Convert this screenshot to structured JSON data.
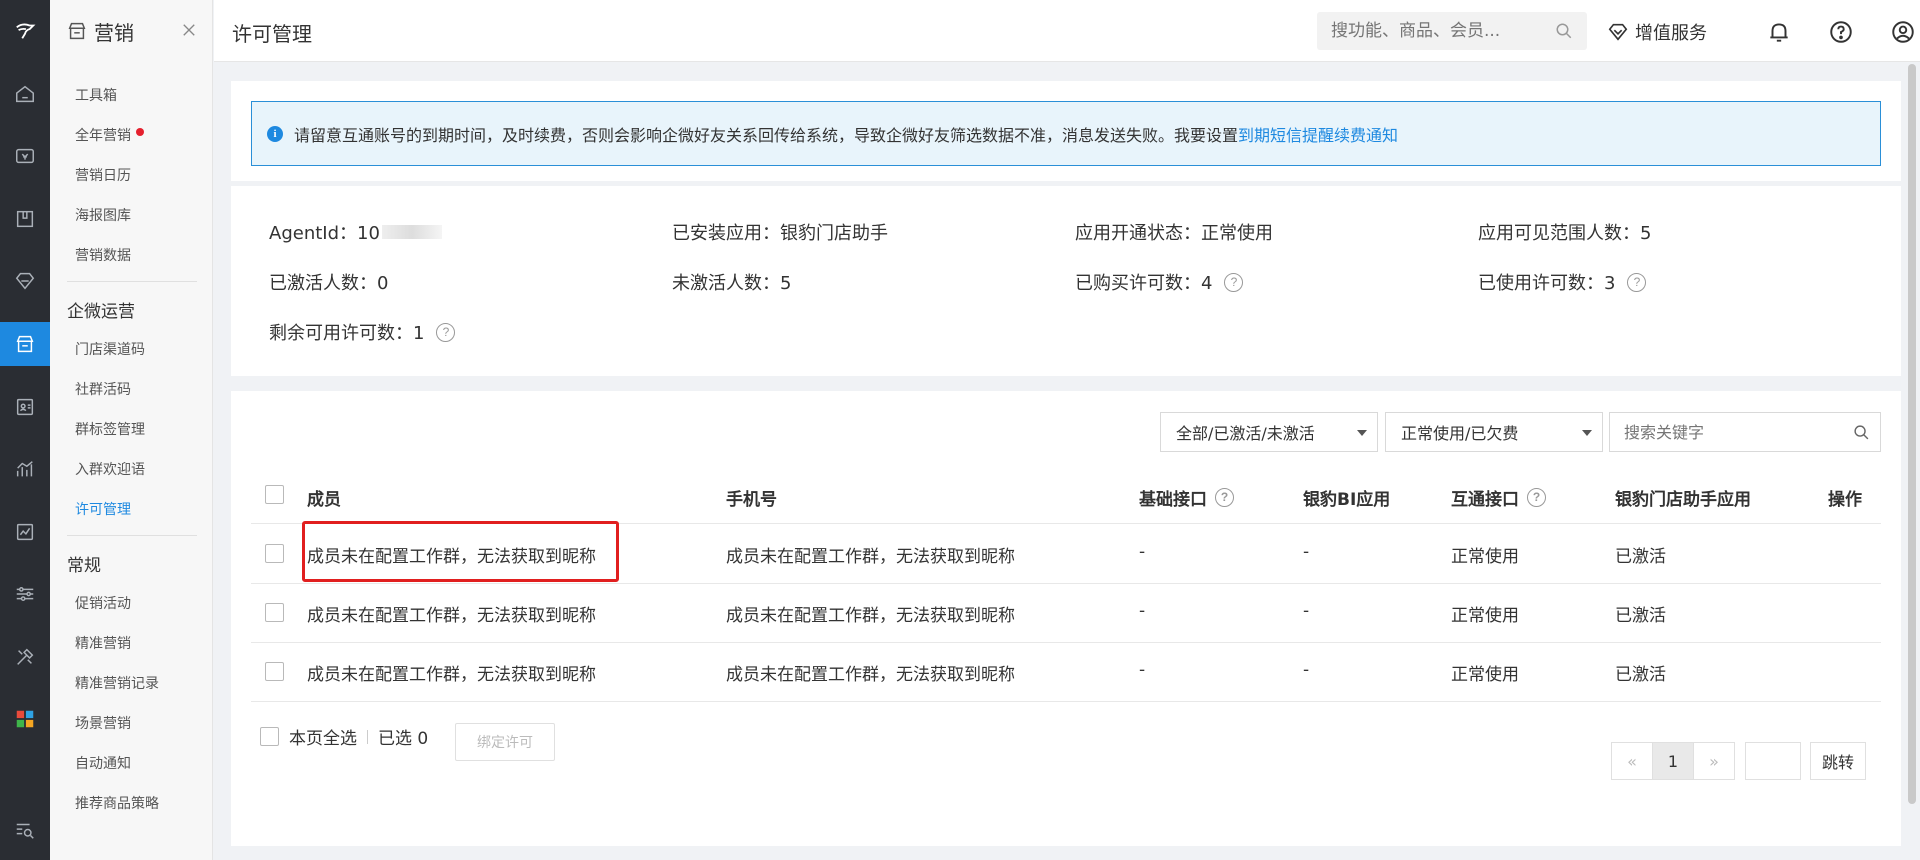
{
  "sidebar_rail": {
    "icons": [
      "logo-icon",
      "home-icon",
      "wallet-icon",
      "box-icon",
      "diamond-icon",
      "store-icon",
      "contact-card-icon",
      "analytics-icon",
      "report-icon",
      "sliders-icon",
      "tools-icon",
      "apps-grid-icon",
      "search-list-icon"
    ]
  },
  "sub_sidebar": {
    "title": "营销",
    "items_top": [
      "工具箱",
      "全年营销",
      "营销日历",
      "海报图库",
      "营销数据"
    ],
    "section_1": "企微运营",
    "items_mid": [
      "门店渠道码",
      "社群活码",
      "群标签管理",
      "入群欢迎语",
      "许可管理"
    ],
    "section_2": "常规",
    "items_bottom": [
      "促销活动",
      "精准营销",
      "精准营销记录",
      "场景营销",
      "自动通知",
      "推荐商品策略"
    ]
  },
  "topbar": {
    "page_title": "许可管理",
    "search_placeholder": "搜功能、商品、会员...",
    "value_added": "增值服务"
  },
  "notice": {
    "text": "请留意互通账号的到期时间，及时续费，否则会影响企微好友关系回传给系统，导致企微好友筛选数据不准，消息发送失败。我要设置",
    "link": "到期短信提醒续费通知"
  },
  "info": {
    "agent_id": "AgentId：10",
    "installed_app": "已安装应用：银豹门店助手",
    "app_status": "应用开通状态：正常使用",
    "visible_count": "应用可见范围人数：5",
    "activated": "已激活人数：0",
    "not_activated": "未激活人数：5",
    "purchased": "已购买许可数：4",
    "used": "已使用许可数：3",
    "remaining": "剩余可用许可数：1"
  },
  "filters": {
    "activation": "全部/已激活/未激活",
    "status": "正常使用/已欠费",
    "keyword_placeholder": "搜索关键字"
  },
  "table": {
    "headers": [
      "成员",
      "手机号",
      "基础接口",
      "银豹BI应用",
      "互通接口",
      "银豹门店助手应用",
      "操作"
    ],
    "rows": [
      {
        "member": "成员未在配置工作群，无法获取到昵称",
        "phone": "成员未在配置工作群，无法获取到昵称",
        "basic": "-",
        "bi": "-",
        "interop": "正常使用",
        "assistant": "已激活"
      },
      {
        "member": "成员未在配置工作群，无法获取到昵称",
        "phone": "成员未在配置工作群，无法获取到昵称",
        "basic": "-",
        "bi": "-",
        "interop": "正常使用",
        "assistant": "已激活"
      },
      {
        "member": "成员未在配置工作群，无法获取到昵称",
        "phone": "成员未在配置工作群，无法获取到昵称",
        "basic": "-",
        "bi": "-",
        "interop": "正常使用",
        "assistant": "已激活"
      }
    ]
  },
  "footer": {
    "select_page": "本页全选",
    "selected": "已选 0",
    "bind": "绑定许可",
    "prev": "«",
    "page": "1",
    "next": "»",
    "jump": "跳转"
  },
  "colors": {
    "accent": "#1e89e0",
    "rail": "#2a2d33",
    "highlight": "#e11f1f",
    "badge": "#e5202e"
  }
}
